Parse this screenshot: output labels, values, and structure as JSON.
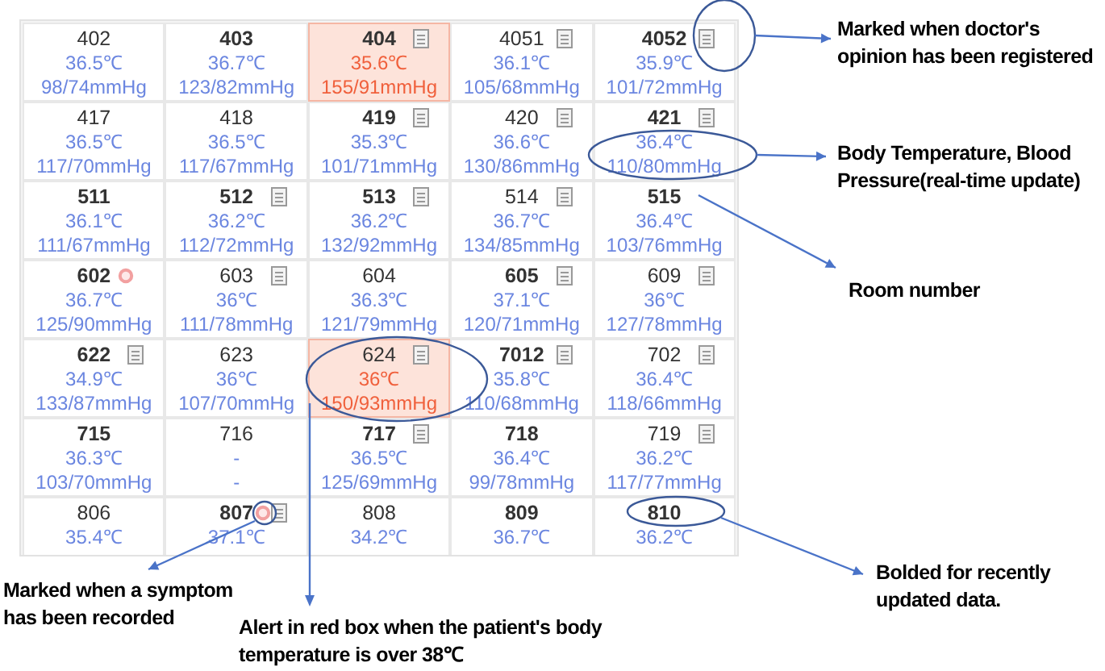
{
  "rooms": [
    [
      {
        "room": "402",
        "bold": false,
        "doc": false,
        "symptom": false,
        "alert": false,
        "temp": "36.5℃",
        "bp": "98/74mmHg"
      },
      {
        "room": "403",
        "bold": true,
        "doc": false,
        "symptom": false,
        "alert": false,
        "temp": "36.7℃",
        "bp": "123/82mmHg"
      },
      {
        "room": "404",
        "bold": true,
        "doc": true,
        "symptom": false,
        "alert": true,
        "temp": "35.6℃",
        "bp": "155/91mmHg"
      },
      {
        "room": "4051",
        "bold": false,
        "doc": true,
        "symptom": false,
        "alert": false,
        "temp": "36.1℃",
        "bp": "105/68mmHg"
      },
      {
        "room": "4052",
        "bold": true,
        "doc": true,
        "symptom": false,
        "alert": false,
        "temp": "35.9℃",
        "bp": "101/72mmHg"
      }
    ],
    [
      {
        "room": "417",
        "bold": false,
        "doc": false,
        "symptom": false,
        "alert": false,
        "temp": "36.5℃",
        "bp": "117/70mmHg"
      },
      {
        "room": "418",
        "bold": false,
        "doc": false,
        "symptom": false,
        "alert": false,
        "temp": "36.5℃",
        "bp": "117/67mmHg"
      },
      {
        "room": "419",
        "bold": true,
        "doc": true,
        "symptom": false,
        "alert": false,
        "temp": "35.3℃",
        "bp": "101/71mmHg"
      },
      {
        "room": "420",
        "bold": false,
        "doc": true,
        "symptom": false,
        "alert": false,
        "temp": "36.6℃",
        "bp": "130/86mmHg"
      },
      {
        "room": "421",
        "bold": true,
        "doc": true,
        "symptom": false,
        "alert": false,
        "temp": "36.4℃",
        "bp": "110/80mmHg"
      }
    ],
    [
      {
        "room": "511",
        "bold": true,
        "doc": false,
        "symptom": false,
        "alert": false,
        "temp": "36.1℃",
        "bp": "111/67mmHg"
      },
      {
        "room": "512",
        "bold": true,
        "doc": true,
        "symptom": false,
        "alert": false,
        "temp": "36.2℃",
        "bp": "112/72mmHg"
      },
      {
        "room": "513",
        "bold": true,
        "doc": true,
        "symptom": false,
        "alert": false,
        "temp": "36.2℃",
        "bp": "132/92mmHg"
      },
      {
        "room": "514",
        "bold": false,
        "doc": true,
        "symptom": false,
        "alert": false,
        "temp": "36.7℃",
        "bp": "134/85mmHg"
      },
      {
        "room": "515",
        "bold": true,
        "doc": false,
        "symptom": false,
        "alert": false,
        "temp": "36.4℃",
        "bp": "103/76mmHg"
      }
    ],
    [
      {
        "room": "602",
        "bold": true,
        "doc": false,
        "symptom": true,
        "alert": false,
        "temp": "36.7℃",
        "bp": "125/90mmHg"
      },
      {
        "room": "603",
        "bold": false,
        "doc": true,
        "symptom": false,
        "alert": false,
        "temp": "36℃",
        "bp": "111/78mmHg"
      },
      {
        "room": "604",
        "bold": false,
        "doc": false,
        "symptom": false,
        "alert": false,
        "temp": "36.3℃",
        "bp": "121/79mmHg"
      },
      {
        "room": "605",
        "bold": true,
        "doc": true,
        "symptom": false,
        "alert": false,
        "temp": "37.1℃",
        "bp": "120/71mmHg"
      },
      {
        "room": "609",
        "bold": false,
        "doc": true,
        "symptom": false,
        "alert": false,
        "temp": "36℃",
        "bp": "127/78mmHg"
      }
    ],
    [
      {
        "room": "622",
        "bold": true,
        "doc": true,
        "symptom": false,
        "alert": false,
        "temp": "34.9℃",
        "bp": "133/87mmHg"
      },
      {
        "room": "623",
        "bold": false,
        "doc": false,
        "symptom": false,
        "alert": false,
        "temp": "36℃",
        "bp": "107/70mmHg"
      },
      {
        "room": "624",
        "bold": false,
        "doc": true,
        "symptom": false,
        "alert": true,
        "temp": "36℃",
        "bp": "150/93mmHg"
      },
      {
        "room": "7012",
        "bold": true,
        "doc": true,
        "symptom": false,
        "alert": false,
        "temp": "35.8℃",
        "bp": "110/68mmHg"
      },
      {
        "room": "702",
        "bold": false,
        "doc": true,
        "symptom": false,
        "alert": false,
        "temp": "36.4℃",
        "bp": "118/66mmHg"
      }
    ],
    [
      {
        "room": "715",
        "bold": true,
        "doc": false,
        "symptom": false,
        "alert": false,
        "temp": "36.3℃",
        "bp": "103/70mmHg"
      },
      {
        "room": "716",
        "bold": false,
        "doc": false,
        "symptom": false,
        "alert": false,
        "temp": "-",
        "bp": "-"
      },
      {
        "room": "717",
        "bold": true,
        "doc": true,
        "symptom": false,
        "alert": false,
        "temp": "36.5℃",
        "bp": "125/69mmHg"
      },
      {
        "room": "718",
        "bold": true,
        "doc": false,
        "symptom": false,
        "alert": false,
        "temp": "36.4℃",
        "bp": "99/78mmHg"
      },
      {
        "room": "719",
        "bold": false,
        "doc": true,
        "symptom": false,
        "alert": false,
        "temp": "36.2℃",
        "bp": "117/77mmHg"
      }
    ],
    [
      {
        "room": "806",
        "bold": false,
        "doc": false,
        "symptom": false,
        "alert": false,
        "temp": "35.4℃"
      },
      {
        "room": "807",
        "bold": true,
        "doc": true,
        "symptom": true,
        "alert": false,
        "temp": "37.1℃"
      },
      {
        "room": "808",
        "bold": false,
        "doc": false,
        "symptom": false,
        "alert": false,
        "temp": "34.2℃"
      },
      {
        "room": "809",
        "bold": true,
        "doc": false,
        "symptom": false,
        "alert": false,
        "temp": "36.7℃"
      },
      {
        "room": "810",
        "bold": true,
        "doc": false,
        "symptom": false,
        "alert": false,
        "temp": "36.2℃"
      }
    ]
  ],
  "annotations": [
    {
      "text": "Marked when doctor's opinion has been registered"
    },
    {
      "text": "Body Temperature, Blood Pressure(real-time update)"
    },
    {
      "text": "Room number"
    },
    {
      "text": "Alert in red box when the patient's body temperature is over 38℃"
    },
    {
      "text": "Marked when a symptom has been recorded"
    },
    {
      "text": "Bolded for recently updated data."
    }
  ]
}
